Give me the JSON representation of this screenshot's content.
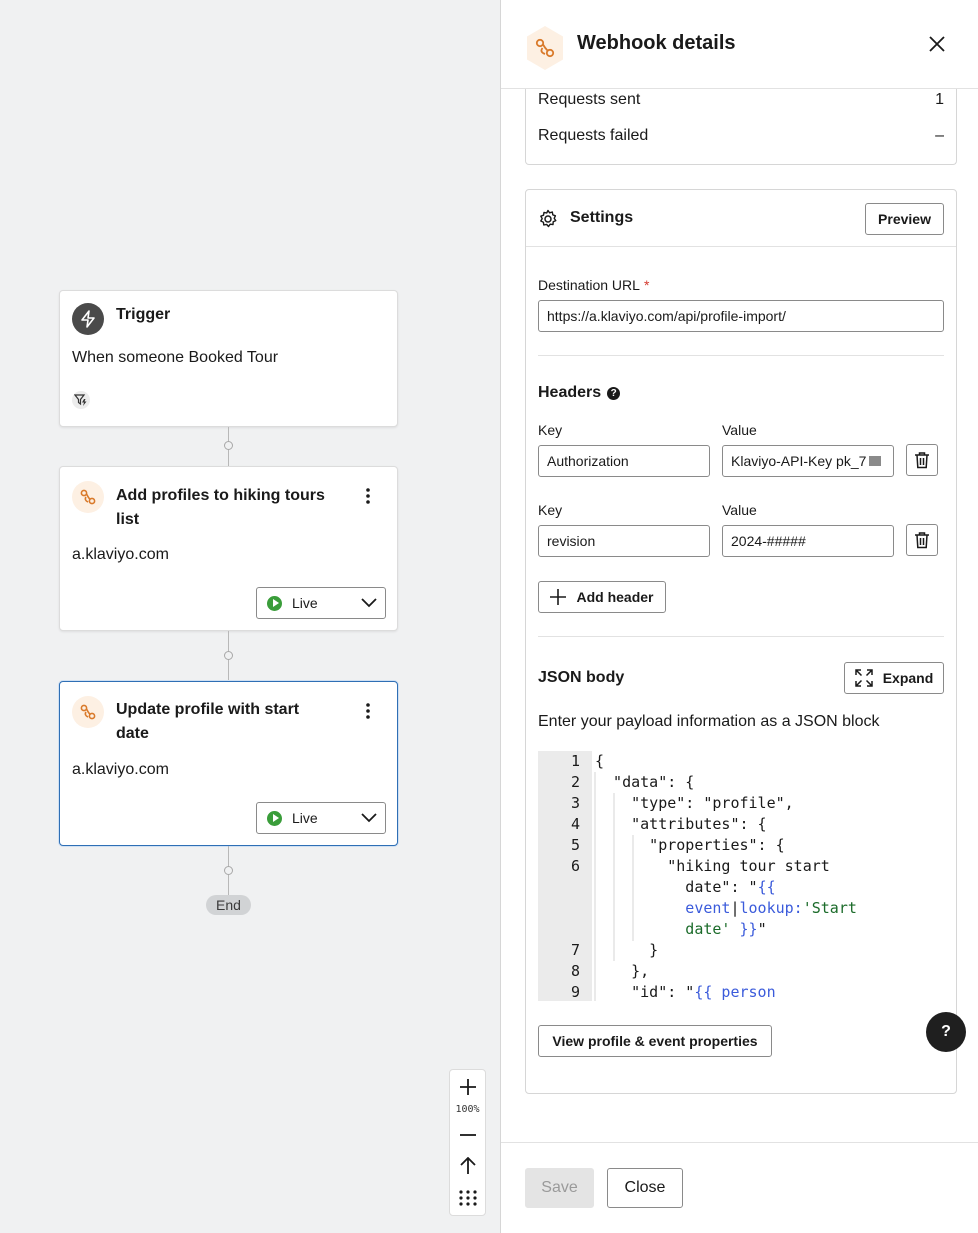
{
  "canvas": {
    "trigger": {
      "title": "Trigger",
      "description": "When someone Booked Tour",
      "icon": "lightning-icon",
      "filter_icon": "filter-lightning-icon"
    },
    "steps": [
      {
        "title_line1": "Add profiles to hiking tours",
        "title_line2": "list",
        "domain": "a.klaviyo.com",
        "status": "Live",
        "icon": "webhook-icon"
      },
      {
        "title_line1": "Update profile with start",
        "title_line2": "date",
        "domain": "a.klaviyo.com",
        "status": "Live",
        "icon": "webhook-icon"
      }
    ],
    "end_label": "End",
    "zoom": {
      "level": "100%",
      "zoom_in_icon": "plus-icon",
      "zoom_out_icon": "minus-icon",
      "recenter_icon": "arrow-up-icon",
      "grid_icon": "grid-dots-icon"
    }
  },
  "panel": {
    "title": "Webhook details",
    "stats": [
      {
        "label": "Requests sent",
        "value": "1"
      },
      {
        "label": "Requests failed",
        "value": "–"
      }
    ],
    "settings": {
      "title": "Settings",
      "preview_label": "Preview",
      "destination_label": "Destination URL",
      "required_mark": "*",
      "destination_value": "https://a.klaviyo.com/api/profile-import/",
      "headers_title": "Headers",
      "headers_help": "?",
      "key_label": "Key",
      "value_label": "Value",
      "headers": [
        {
          "key": "Authorization",
          "value": "Klaviyo-API-Key pk_7"
        },
        {
          "key": "revision",
          "value": "2024-#####"
        }
      ],
      "add_header_label": "Add header",
      "json_title": "JSON body",
      "expand_label": "Expand",
      "json_description": "Enter your payload information as a JSON block",
      "code_lines": [
        {
          "n": "1",
          "text": "{"
        },
        {
          "n": "2",
          "text": "  \"data\": {"
        },
        {
          "n": "3",
          "text": "    \"type\": \"profile\","
        },
        {
          "n": "4",
          "text": "    \"attributes\": {"
        },
        {
          "n": "5",
          "text": "      \"properties\": {"
        },
        {
          "n": "6",
          "text": "        \"hiking tour start"
        },
        {
          "n": "",
          "text": "          date\": \"",
          "tmpl": "{{"
        },
        {
          "n": "",
          "text": "          event",
          "bar": "|",
          "rest": "lookup:",
          "str": "'Start"
        },
        {
          "n": "",
          "str": "          date'",
          "tmpl": " }}",
          "after": "\""
        },
        {
          "n": "7",
          "text": "      }"
        },
        {
          "n": "8",
          "text": "    },"
        },
        {
          "n": "9",
          "text": "    \"id\": \"",
          "tmpl": "{{ person"
        }
      ],
      "view_properties_label": "View profile & event properties"
    },
    "help_label": "?",
    "footer": {
      "save_label": "Save",
      "close_label": "Close"
    }
  }
}
